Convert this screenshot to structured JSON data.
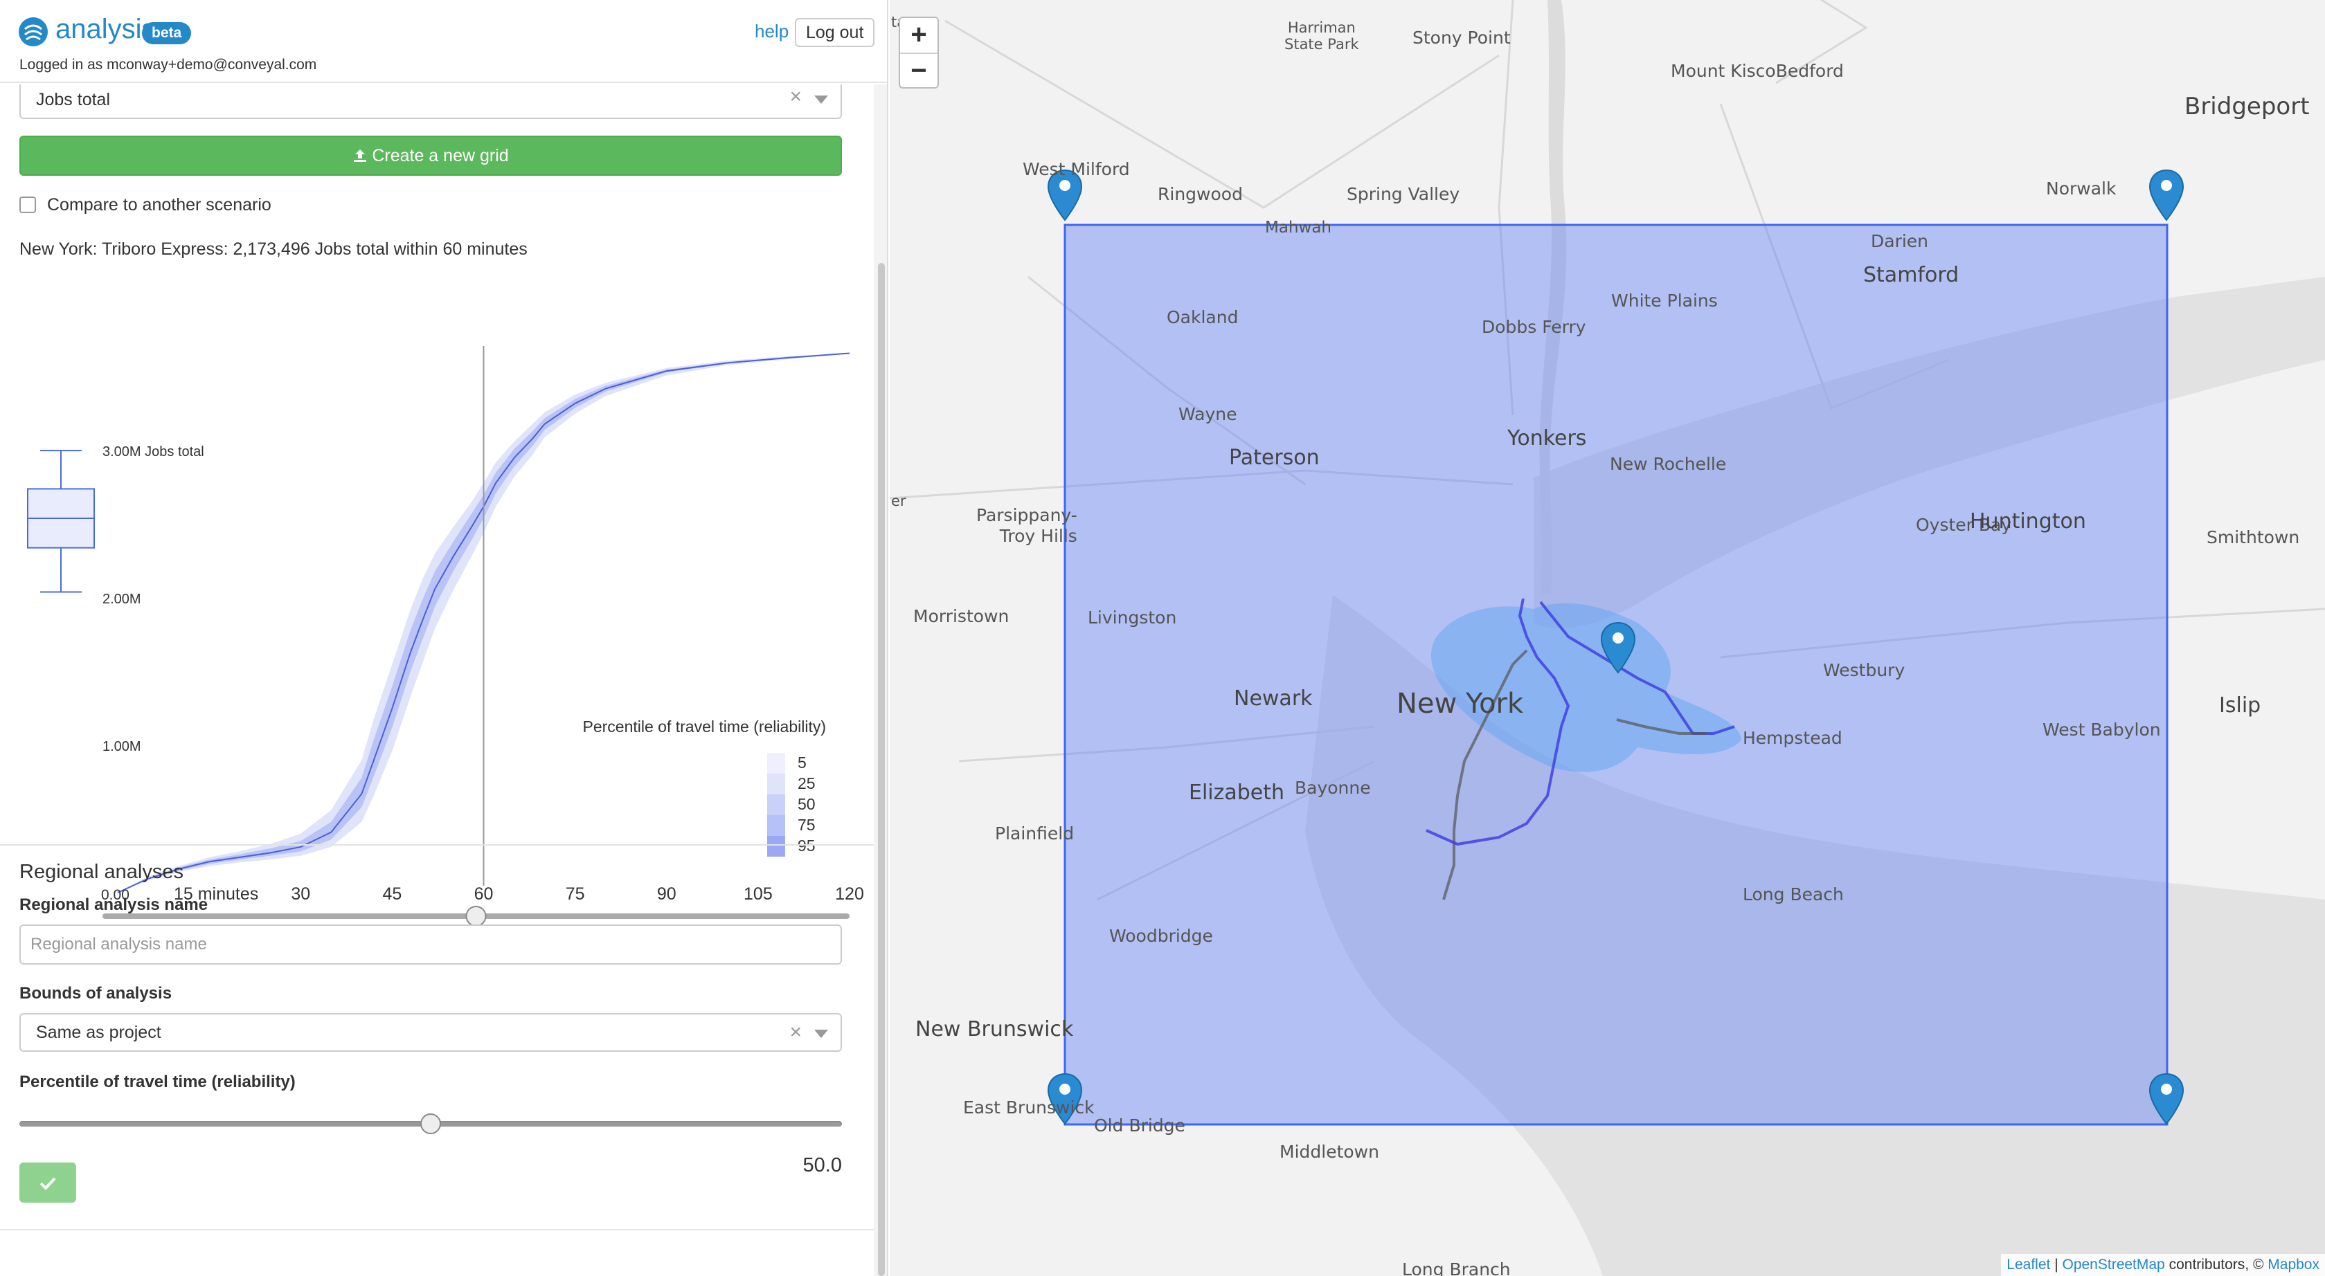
{
  "header": {
    "brand": "analysis",
    "badge": "beta",
    "help": "help",
    "logout": "Log out",
    "logged_in": "Logged in as mconway+demo@conveyal.com"
  },
  "opportunity": {
    "selected": "Jobs total",
    "clear": "×"
  },
  "create_grid": {
    "label": "Create a new grid"
  },
  "compare": {
    "label": "Compare to another scenario"
  },
  "summary": "New York: Triboro Express: 2,173,496 Jobs total within 60 minutes",
  "chart": {
    "y_labels": [
      "3.00M Jobs total",
      "2.00M",
      "1.00M"
    ],
    "x_labels": [
      "0.00",
      "15 minutes",
      "30",
      "45",
      "60",
      "75",
      "90",
      "105",
      "120"
    ],
    "legend_title": "Percentile of travel time (reliability)",
    "legend_items": [
      "5",
      "25",
      "50",
      "75",
      "95"
    ]
  },
  "chart_data": {
    "type": "area",
    "title": "",
    "xlabel": "minutes",
    "ylabel": "Jobs total",
    "xlim": [
      0,
      120
    ],
    "ylim": [
      0,
      3700000
    ],
    "x": [
      0,
      5,
      10,
      15,
      20,
      25,
      30,
      35,
      40,
      42,
      45,
      48,
      50,
      52,
      55,
      58,
      60,
      62,
      65,
      68,
      70,
      75,
      80,
      90,
      100,
      110,
      120
    ],
    "series": [
      {
        "name": "5",
        "values": [
          0,
          110000,
          180000,
          240000,
          280000,
          330000,
          400000,
          560000,
          900000,
          1180000,
          1550000,
          1920000,
          2130000,
          2300000,
          2480000,
          2650000,
          2780000,
          2920000,
          3060000,
          3180000,
          3260000,
          3380000,
          3460000,
          3560000,
          3610000,
          3640000,
          3660000
        ]
      },
      {
        "name": "25",
        "values": [
          0,
          100000,
          170000,
          225000,
          260000,
          300000,
          350000,
          480000,
          780000,
          1040000,
          1400000,
          1780000,
          1990000,
          2180000,
          2380000,
          2570000,
          2700000,
          2850000,
          3010000,
          3130000,
          3220000,
          3350000,
          3440000,
          3550000,
          3600000,
          3635000,
          3660000
        ]
      },
      {
        "name": "50",
        "values": [
          0,
          95000,
          160000,
          210000,
          240000,
          270000,
          310000,
          410000,
          670000,
          900000,
          1250000,
          1630000,
          1850000,
          2060000,
          2280000,
          2480000,
          2620000,
          2780000,
          2950000,
          3080000,
          3180000,
          3320000,
          3420000,
          3540000,
          3595000,
          3630000,
          3660000
        ]
      },
      {
        "name": "75",
        "values": [
          0,
          90000,
          150000,
          195000,
          225000,
          250000,
          280000,
          360000,
          580000,
          790000,
          1120000,
          1500000,
          1720000,
          1940000,
          2180000,
          2390000,
          2540000,
          2710000,
          2890000,
          3030000,
          3140000,
          3290000,
          3400000,
          3530000,
          3590000,
          3625000,
          3660000
        ]
      },
      {
        "name": "95",
        "values": [
          0,
          85000,
          140000,
          180000,
          205000,
          225000,
          250000,
          310000,
          480000,
          660000,
          960000,
          1330000,
          1560000,
          1790000,
          2050000,
          2280000,
          2440000,
          2620000,
          2820000,
          2970000,
          3090000,
          3250000,
          3370000,
          3510000,
          3580000,
          3620000,
          3660000
        ]
      }
    ],
    "cutoff_minutes": 60,
    "boxplot": {
      "min": 2040000,
      "q1": 2340000,
      "median": 2540000,
      "q3": 2740000,
      "max": 3000000
    },
    "legend": "bottom-right"
  },
  "cutoff_slider": {
    "value": 60,
    "min": 0,
    "max": 120
  },
  "regional": {
    "section_title": "Regional analyses",
    "name_label": "Regional analysis name",
    "name_placeholder": "Regional analysis name",
    "bounds_label": "Bounds of analysis",
    "bounds_value": "Same as project",
    "bounds_clear": "×",
    "percentile_label": "Percentile of travel time (reliability)",
    "percentile_value": "50.0",
    "percentile_fraction": 0.5
  },
  "map": {
    "zoom_in": "+",
    "zoom_out": "−",
    "labels": {
      "harriman": "Harriman\nState Park",
      "stony_point": "Stony Point",
      "mount_kisco": "Mount KiscoBedford",
      "bridgeport": "Bridgeport",
      "west_milford": "West Milford",
      "ringwood": "Ringwood",
      "spring_valley": "Spring Valley",
      "norwalk": "Norwalk",
      "mahwah": "Mahwah",
      "darien": "Darien",
      "stamford": "Stamford",
      "oakland": "Oakland",
      "dobbs_ferry": "Dobbs Ferry",
      "white_plains": "White Plains",
      "wayne": "Wayne",
      "yonkers": "Yonkers",
      "paterson": "Paterson",
      "new_rochelle": "New Rochelle",
      "parsippany": "Parsippany-\nTroy Hills",
      "oyster_bay": "Oyster Bay",
      "huntington": "Huntington",
      "smithtown": "Smithtown",
      "morristown": "Morristown",
      "livingston": "Livingston",
      "westbury": "Westbury",
      "newark": "Newark",
      "new_york": "New York",
      "islip": "Islip",
      "hempstead": "Hempstead",
      "west_babylon": "West Babylon",
      "elizabeth": "Elizabeth",
      "bayonne": "Bayonne",
      "plainfield": "Plainfield",
      "long_beach": "Long Beach",
      "woodbridge": "Woodbridge",
      "new_brunswick": "New Brunswick",
      "east_brunswick": "East Brunswick",
      "old_bridge": "Old Bridge",
      "middletown": "Middletown",
      "long_branch": "Long Branch",
      "edge_ta": "ta",
      "edge_er": "er"
    },
    "attribution": {
      "leaflet": "Leaflet",
      "sep": " | ",
      "osm": "OpenStreetMap",
      "contrib": " contributors, © ",
      "mapbox": "Mapbox"
    },
    "colors": {
      "bounds_fill": "#5a7cf5",
      "isochrone": "#6aa8f0",
      "route": "#3a3ae0",
      "marker": "#2a8ad2"
    }
  }
}
